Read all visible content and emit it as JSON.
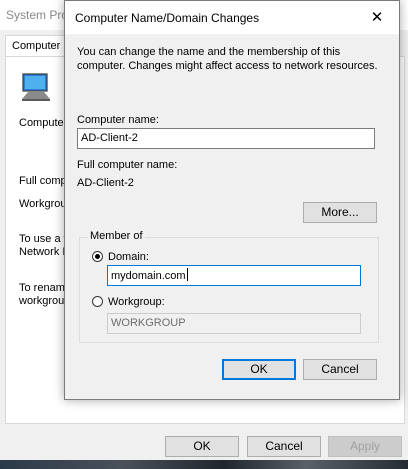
{
  "background_window": {
    "title": "System Pro",
    "tab_label": "Computer N",
    "computer_desc_label": "Computer",
    "full_computer_label": "Full compu",
    "workgroup_label": "Workgrou",
    "wizard_text_1": "To use a w",
    "wizard_text_2": "Network I",
    "rename_text_1": "To renam",
    "rename_text_2": "workgroup",
    "ok_label": "OK",
    "cancel_label": "Cancel",
    "apply_label": "Apply"
  },
  "dialog": {
    "title": "Computer Name/Domain Changes",
    "close_glyph": "✕",
    "intro_line_1": "You can change the name and the membership of this",
    "intro_line_2": "computer. Changes might affect access to network resources.",
    "computer_name_label": "Computer name:",
    "computer_name_value": "AD-Client-2",
    "full_name_label": "Full computer name:",
    "full_name_value": "AD-Client-2",
    "more_label": "More...",
    "member_of_label": "Member of",
    "domain_label": "Domain:",
    "domain_value": "mydomain.com",
    "domain_selected": true,
    "workgroup_label": "Workgroup:",
    "workgroup_value": "WORKGROUP",
    "workgroup_selected": false,
    "ok_label": "OK",
    "cancel_label": "Cancel"
  },
  "colors": {
    "focus_accent": "#0078d7",
    "window_bg": "#f0f0f0",
    "titlebar_bg": "#ffffff"
  }
}
